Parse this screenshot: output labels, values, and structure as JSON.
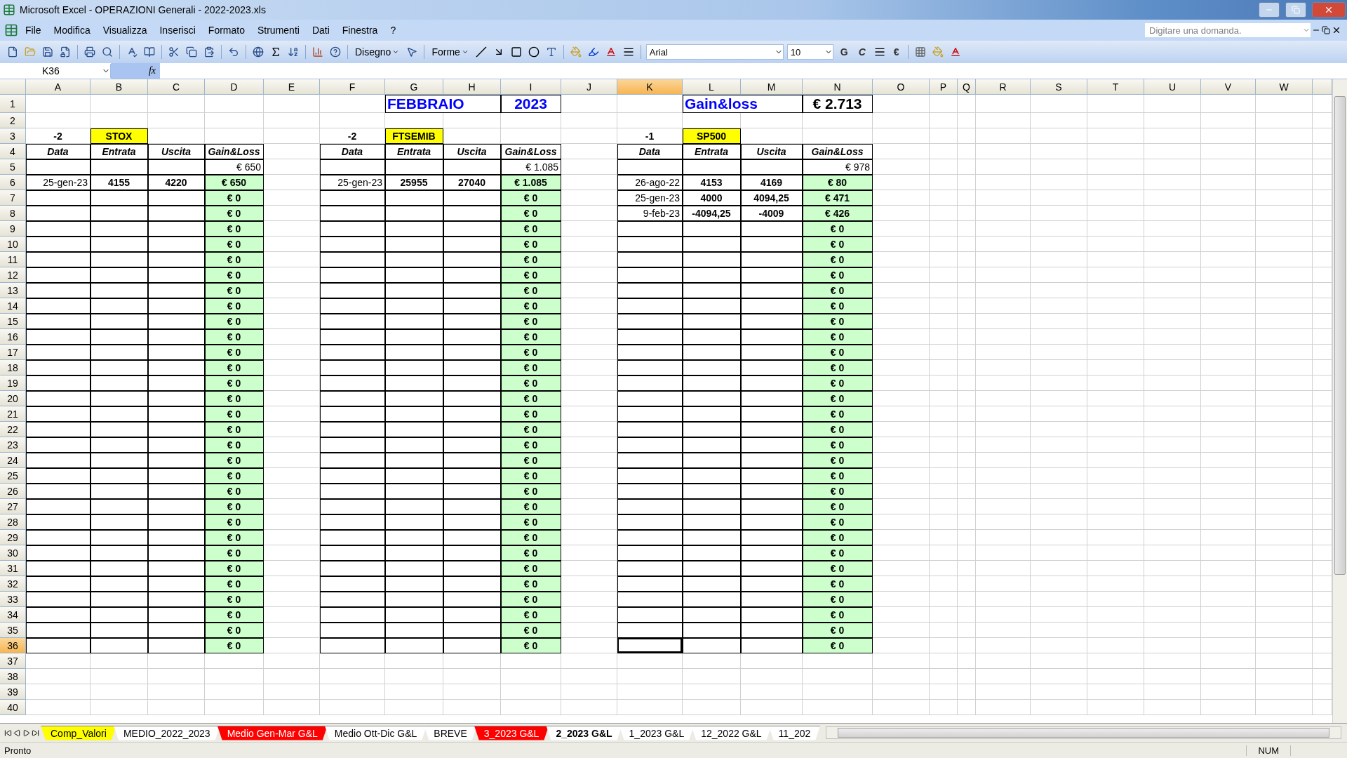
{
  "window": {
    "title": "Microsoft Excel - OPERAZIONI Generali - 2022-2023.xls"
  },
  "menu": [
    "File",
    "Modifica",
    "Visualizza",
    "Inserisci",
    "Formato",
    "Strumenti",
    "Dati",
    "Finestra",
    "?"
  ],
  "help_box": {
    "placeholder": "Digitare una domanda."
  },
  "toolbar": {
    "drawing_menu": "Disegno",
    "shapes_menu": "Forme",
    "font": "Arial",
    "size": "10",
    "bold_key": "G",
    "italic_key": "C",
    "euro_key": "€"
  },
  "formula_bar": {
    "cell_ref": "K36",
    "fx": "fx"
  },
  "columns": [
    {
      "label": "A",
      "selected": false
    },
    {
      "label": "B",
      "selected": false
    },
    {
      "label": "C",
      "selected": false
    },
    {
      "label": "D",
      "selected": false
    },
    {
      "label": "E",
      "selected": false
    },
    {
      "label": "F",
      "selected": false
    },
    {
      "label": "G",
      "selected": false
    },
    {
      "label": "H",
      "selected": false
    },
    {
      "label": "I",
      "selected": false
    },
    {
      "label": "J",
      "selected": false
    },
    {
      "label": "K",
      "selected": true
    },
    {
      "label": "L",
      "selected": false
    },
    {
      "label": "M",
      "selected": false
    },
    {
      "label": "N",
      "selected": false
    },
    {
      "label": "O",
      "selected": false
    },
    {
      "label": "P",
      "selected": false
    },
    {
      "label": "Q",
      "selected": false
    },
    {
      "label": "R",
      "selected": false
    },
    {
      "label": "S",
      "selected": false
    },
    {
      "label": "T",
      "selected": false
    },
    {
      "label": "U",
      "selected": false
    },
    {
      "label": "V",
      "selected": false
    },
    {
      "label": "W",
      "selected": false
    }
  ],
  "rows": [
    {
      "label": "1",
      "selected": false
    },
    {
      "label": "2",
      "selected": false
    },
    {
      "label": "3",
      "selected": false
    },
    {
      "label": "4",
      "selected": false
    },
    {
      "label": "5",
      "selected": false
    },
    {
      "label": "6",
      "selected": false
    },
    {
      "label": "7",
      "selected": false
    },
    {
      "label": "8",
      "selected": false
    },
    {
      "label": "9",
      "selected": false
    },
    {
      "label": "10",
      "selected": false
    },
    {
      "label": "11",
      "selected": false
    },
    {
      "label": "12",
      "selected": false
    },
    {
      "label": "13",
      "selected": false
    },
    {
      "label": "14",
      "selected": false
    },
    {
      "label": "15",
      "selected": false
    },
    {
      "label": "16",
      "selected": false
    },
    {
      "label": "17",
      "selected": false
    },
    {
      "label": "18",
      "selected": false
    },
    {
      "label": "19",
      "selected": false
    },
    {
      "label": "20",
      "selected": false
    },
    {
      "label": "21",
      "selected": false
    },
    {
      "label": "22",
      "selected": false
    },
    {
      "label": "23",
      "selected": false
    },
    {
      "label": "24",
      "selected": false
    },
    {
      "label": "25",
      "selected": false
    },
    {
      "label": "26",
      "selected": false
    },
    {
      "label": "27",
      "selected": false
    },
    {
      "label": "28",
      "selected": false
    },
    {
      "label": "29",
      "selected": false
    },
    {
      "label": "30",
      "selected": false
    },
    {
      "label": "31",
      "selected": false
    },
    {
      "label": "32",
      "selected": false
    },
    {
      "label": "33",
      "selected": false
    },
    {
      "label": "34",
      "selected": false
    },
    {
      "label": "35",
      "selected": false
    },
    {
      "label": "36",
      "selected": true
    },
    {
      "label": "37",
      "selected": false
    },
    {
      "label": "38",
      "selected": false
    },
    {
      "label": "39",
      "selected": false
    },
    {
      "label": "40",
      "selected": false
    }
  ],
  "header_row": {
    "month": "FEBBRAIO",
    "year": "2023",
    "summary_label": "Gain&loss",
    "summary_total": "€ 2.713"
  },
  "blocks": [
    {
      "multiplier": "-2",
      "name": "STOX",
      "headers": [
        "Data",
        "Entrata",
        "Uscita",
        "Gain&Loss"
      ],
      "total": "€ 650",
      "trades": [
        {
          "date": "25-gen-23",
          "entry": "4155",
          "exit": "4220",
          "gain": "€ 650"
        },
        {
          "gain": "€ 0"
        },
        {
          "gain": "€ 0"
        },
        {
          "gain": "€ 0"
        },
        {
          "gain": "€ 0"
        },
        {
          "gain": "€ 0"
        },
        {
          "gain": "€ 0"
        },
        {
          "gain": "€ 0"
        },
        {
          "gain": "€ 0"
        },
        {
          "gain": "€ 0"
        },
        {
          "gain": "€ 0"
        },
        {
          "gain": "€ 0"
        },
        {
          "gain": "€ 0"
        },
        {
          "gain": "€ 0"
        },
        {
          "gain": "€ 0"
        },
        {
          "gain": "€ 0"
        },
        {
          "gain": "€ 0"
        },
        {
          "gain": "€ 0"
        },
        {
          "gain": "€ 0"
        },
        {
          "gain": "€ 0"
        },
        {
          "gain": "€ 0"
        },
        {
          "gain": "€ 0"
        },
        {
          "gain": "€ 0"
        },
        {
          "gain": "€ 0"
        },
        {
          "gain": "€ 0"
        },
        {
          "gain": "€ 0"
        },
        {
          "gain": "€ 0"
        },
        {
          "gain": "€ 0"
        },
        {
          "gain": "€ 0"
        },
        {
          "gain": "€ 0"
        },
        {
          "gain": "€ 0"
        }
      ]
    },
    {
      "multiplier": "-2",
      "name": "FTSEMIB",
      "headers": [
        "Data",
        "Entrata",
        "Uscita",
        "Gain&Loss"
      ],
      "total": "€ 1.085",
      "trades": [
        {
          "date": "25-gen-23",
          "entry": "25955",
          "exit": "27040",
          "gain": "€ 1.085"
        },
        {
          "gain": "€ 0"
        },
        {
          "gain": "€ 0"
        },
        {
          "gain": "€ 0"
        },
        {
          "gain": "€ 0"
        },
        {
          "gain": "€ 0"
        },
        {
          "gain": "€ 0"
        },
        {
          "gain": "€ 0"
        },
        {
          "gain": "€ 0"
        },
        {
          "gain": "€ 0"
        },
        {
          "gain": "€ 0"
        },
        {
          "gain": "€ 0"
        },
        {
          "gain": "€ 0"
        },
        {
          "gain": "€ 0"
        },
        {
          "gain": "€ 0"
        },
        {
          "gain": "€ 0"
        },
        {
          "gain": "€ 0"
        },
        {
          "gain": "€ 0"
        },
        {
          "gain": "€ 0"
        },
        {
          "gain": "€ 0"
        },
        {
          "gain": "€ 0"
        },
        {
          "gain": "€ 0"
        },
        {
          "gain": "€ 0"
        },
        {
          "gain": "€ 0"
        },
        {
          "gain": "€ 0"
        },
        {
          "gain": "€ 0"
        },
        {
          "gain": "€ 0"
        },
        {
          "gain": "€ 0"
        },
        {
          "gain": "€ 0"
        },
        {
          "gain": "€ 0"
        },
        {
          "gain": "€ 0"
        }
      ]
    },
    {
      "multiplier": "-1",
      "name": "SP500",
      "headers": [
        "Data",
        "Entrata",
        "Uscita",
        "Gain&Loss"
      ],
      "total": "€ 978",
      "trades": [
        {
          "date": "26-ago-22",
          "entry": "4153",
          "exit": "4169",
          "gain": "€ 80"
        },
        {
          "date": "25-gen-23",
          "entry": "4000",
          "exit": "4094,25",
          "gain": "€ 471"
        },
        {
          "date": "9-feb-23",
          "entry": "-4094,25",
          "exit": "-4009",
          "gain": "€ 426"
        },
        {
          "gain": "€ 0"
        },
        {
          "gain": "€ 0"
        },
        {
          "gain": "€ 0"
        },
        {
          "gain": "€ 0"
        },
        {
          "gain": "€ 0"
        },
        {
          "gain": "€ 0"
        },
        {
          "gain": "€ 0"
        },
        {
          "gain": "€ 0"
        },
        {
          "gain": "€ 0"
        },
        {
          "gain": "€ 0"
        },
        {
          "gain": "€ 0"
        },
        {
          "gain": "€ 0"
        },
        {
          "gain": "€ 0"
        },
        {
          "gain": "€ 0"
        },
        {
          "gain": "€ 0"
        },
        {
          "gain": "€ 0"
        },
        {
          "gain": "€ 0"
        },
        {
          "gain": "€ 0"
        },
        {
          "gain": "€ 0"
        },
        {
          "gain": "€ 0"
        },
        {
          "gain": "€ 0"
        },
        {
          "gain": "€ 0"
        },
        {
          "gain": "€ 0"
        },
        {
          "gain": "€ 0"
        },
        {
          "gain": "€ 0"
        },
        {
          "gain": "€ 0"
        },
        {
          "gain": "€ 0"
        },
        {
          "gain": "€ 0"
        }
      ]
    }
  ],
  "sheet_tabs": [
    {
      "label": "Comp_Valori",
      "selected": false,
      "color": "#ffff00"
    },
    {
      "label": "MEDIO_2022_2023",
      "selected": false,
      "color": "#ffffff"
    },
    {
      "label": "Medio Gen-Mar G&L",
      "selected": false,
      "color": "#ff0000"
    },
    {
      "label": "Medio Ott-Dic G&L",
      "selected": false,
      "color": "#ffffff"
    },
    {
      "label": "BREVE",
      "selected": false,
      "color": "#ffffff"
    },
    {
      "label": "3_2023 G&L",
      "selected": false,
      "color": "#ff0000"
    },
    {
      "label": "2_2023 G&L",
      "selected": true,
      "color": "#ffffff"
    },
    {
      "label": "1_2023 G&L",
      "selected": false,
      "color": "#ffffff"
    },
    {
      "label": "12_2022 G&L",
      "selected": false,
      "color": "#ffffff"
    },
    {
      "label": "11_202",
      "selected": false,
      "color": "#ffffff"
    }
  ],
  "status_bar": {
    "text": "Pronto",
    "num": "NUM"
  }
}
